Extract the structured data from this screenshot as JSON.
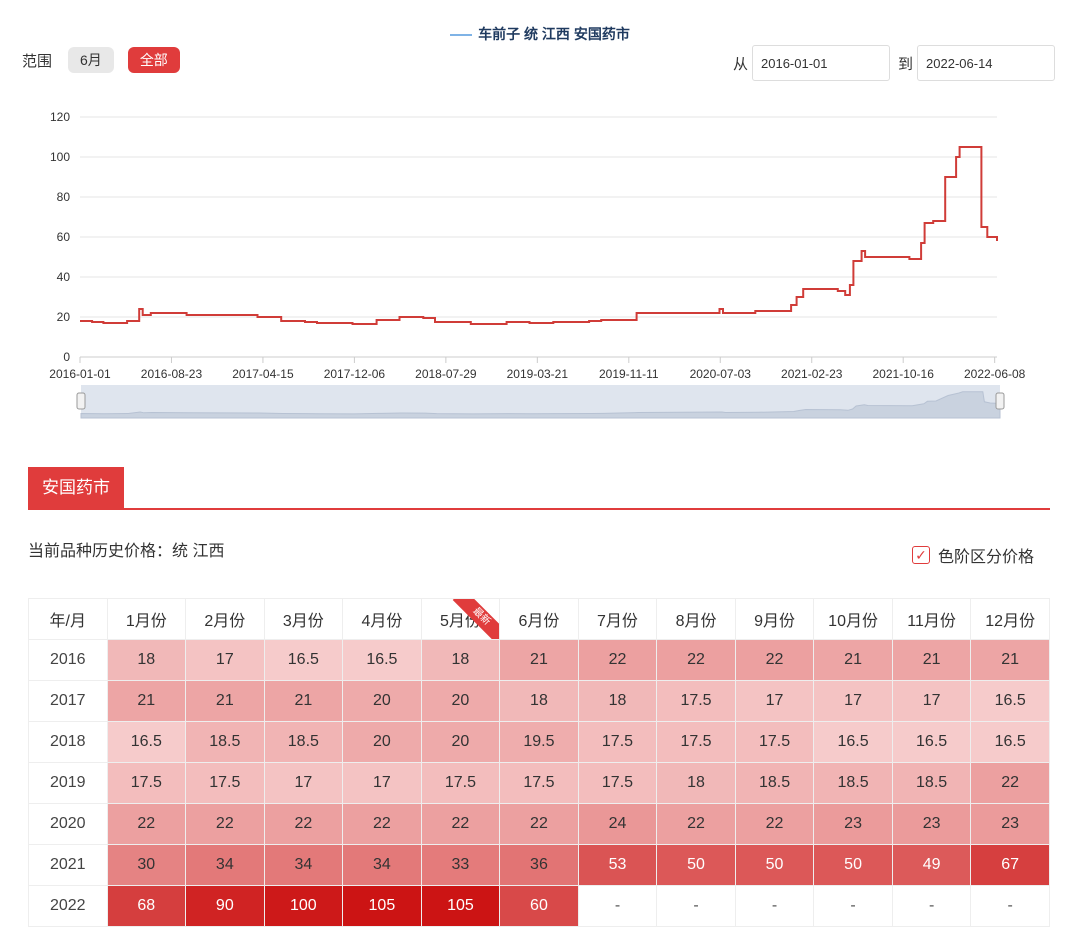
{
  "legend": {
    "series_name": "车前子 统 江西 安国药市",
    "swatch_color": "#7fb3e6"
  },
  "range": {
    "label": "范围",
    "buttons": [
      "6月",
      "全部"
    ],
    "active": "全部"
  },
  "dates": {
    "from_label": "从",
    "from_value": "2016-01-01",
    "to_label": "到",
    "to_value": "2022-06-14"
  },
  "section": {
    "tab": "安国药市"
  },
  "history": {
    "label": "当前品种历史价格：统 江西",
    "toggle_label": "色阶区分价格",
    "toggle_checked": true
  },
  "colors": {
    "accent": "#e03c3c",
    "line": "#d03c38",
    "grid": "#e6e6e6",
    "navigator_fill": "#dfe5ee"
  },
  "table": {
    "corner": "年/月",
    "months": [
      "1月份",
      "2月份",
      "3月份",
      "4月份",
      "5月份",
      "6月份",
      "7月份",
      "8月份",
      "9月份",
      "10月份",
      "11月份",
      "12月份"
    ],
    "new_badge": "最新",
    "rows": [
      {
        "year": "2016",
        "values": [
          "18",
          "17",
          "16.5",
          "16.5",
          "18",
          "21",
          "22",
          "22",
          "22",
          "21",
          "21",
          "21"
        ]
      },
      {
        "year": "2017",
        "values": [
          "21",
          "21",
          "21",
          "20",
          "20",
          "18",
          "18",
          "17.5",
          "17",
          "17",
          "17",
          "16.5"
        ]
      },
      {
        "year": "2018",
        "values": [
          "16.5",
          "18.5",
          "18.5",
          "20",
          "20",
          "19.5",
          "17.5",
          "17.5",
          "17.5",
          "16.5",
          "16.5",
          "16.5"
        ]
      },
      {
        "year": "2019",
        "values": [
          "17.5",
          "17.5",
          "17",
          "17",
          "17.5",
          "17.5",
          "17.5",
          "18",
          "18.5",
          "18.5",
          "18.5",
          "22"
        ]
      },
      {
        "year": "2020",
        "values": [
          "22",
          "22",
          "22",
          "22",
          "22",
          "22",
          "24",
          "22",
          "22",
          "23",
          "23",
          "23"
        ]
      },
      {
        "year": "2021",
        "values": [
          "30",
          "34",
          "34",
          "34",
          "33",
          "36",
          "53",
          "50",
          "50",
          "50",
          "49",
          "67"
        ]
      },
      {
        "year": "2022",
        "values": [
          "68",
          "90",
          "100",
          "105",
          "105",
          "60",
          "-",
          "-",
          "-",
          "-",
          "-",
          "-"
        ]
      }
    ]
  },
  "chart_data": {
    "type": "line",
    "series": [
      {
        "name": "车前子 统 江西 安国药市",
        "points": [
          [
            "2016-01-01",
            18
          ],
          [
            "2016-02-01",
            17.5
          ],
          [
            "2016-03-01",
            17
          ],
          [
            "2016-05-01",
            18
          ],
          [
            "2016-06-01",
            24
          ],
          [
            "2016-06-10",
            21
          ],
          [
            "2016-07-01",
            22
          ],
          [
            "2016-10-01",
            21
          ],
          [
            "2017-04-01",
            20
          ],
          [
            "2017-06-01",
            18
          ],
          [
            "2017-08-01",
            17.5
          ],
          [
            "2017-09-01",
            17
          ],
          [
            "2017-12-01",
            16.5
          ],
          [
            "2018-02-01",
            18.5
          ],
          [
            "2018-04-01",
            20
          ],
          [
            "2018-06-01",
            19.5
          ],
          [
            "2018-07-01",
            17.5
          ],
          [
            "2018-10-01",
            16.5
          ],
          [
            "2019-01-01",
            17.5
          ],
          [
            "2019-03-01",
            17
          ],
          [
            "2019-05-01",
            17.5
          ],
          [
            "2019-08-01",
            18
          ],
          [
            "2019-09-01",
            18.5
          ],
          [
            "2019-12-01",
            22
          ],
          [
            "2020-07-01",
            24
          ],
          [
            "2020-07-10",
            22
          ],
          [
            "2020-10-01",
            23
          ],
          [
            "2021-01-01",
            26
          ],
          [
            "2021-01-15",
            30
          ],
          [
            "2021-02-01",
            34
          ],
          [
            "2021-05-01",
            33
          ],
          [
            "2021-05-20",
            31
          ],
          [
            "2021-06-01",
            36
          ],
          [
            "2021-06-10",
            48
          ],
          [
            "2021-07-01",
            53
          ],
          [
            "2021-07-10",
            50
          ],
          [
            "2021-11-01",
            49
          ],
          [
            "2021-12-01",
            57
          ],
          [
            "2021-12-10",
            67
          ],
          [
            "2022-01-01",
            68
          ],
          [
            "2022-02-01",
            90
          ],
          [
            "2022-03-01",
            100
          ],
          [
            "2022-03-10",
            105
          ],
          [
            "2022-05-01",
            105
          ],
          [
            "2022-05-05",
            65
          ],
          [
            "2022-05-20",
            60
          ],
          [
            "2022-06-14",
            58
          ]
        ]
      }
    ],
    "x_tick_labels": [
      "2016-01-01",
      "2016-08-23",
      "2017-04-15",
      "2017-12-06",
      "2018-07-29",
      "2019-03-21",
      "2019-11-11",
      "2020-07-03",
      "2021-02-23",
      "2021-10-16",
      "2022-06-08"
    ],
    "y_ticks": [
      0,
      20,
      40,
      60,
      80,
      100,
      120
    ],
    "xlim": [
      "2016-01-01",
      "2022-06-14"
    ],
    "ylim": [
      0,
      120
    ],
    "grid": true,
    "navigator": true
  }
}
